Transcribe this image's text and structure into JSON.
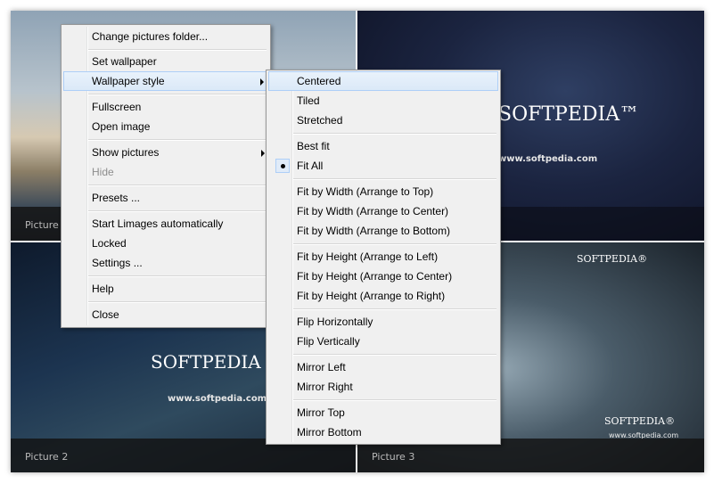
{
  "tiles": [
    {
      "caption": "Picture 1",
      "brand": "",
      "site": ""
    },
    {
      "caption": "",
      "brand": "SOFTPEDIA™",
      "site": "www.softpedia.com"
    },
    {
      "caption": "Picture 2",
      "brand": "SOFTPEDIA",
      "site": "www.softpedia.com"
    },
    {
      "caption": "Picture 3",
      "brand": "SOFTPEDIA®",
      "brand2": "SOFTPEDIA®",
      "site": "www.softpedia.com"
    }
  ],
  "context_menu": {
    "items": [
      {
        "label": "Change pictures folder..."
      },
      {
        "label": "Set wallpaper"
      },
      {
        "label": "Wallpaper style"
      },
      {
        "label": "Fullscreen"
      },
      {
        "label": "Open image"
      },
      {
        "label": "Show pictures"
      },
      {
        "label": "Hide"
      },
      {
        "label": "Presets ..."
      },
      {
        "label": "Start Limages automatically"
      },
      {
        "label": "Locked"
      },
      {
        "label": "Settings ..."
      },
      {
        "label": "Help"
      },
      {
        "label": "Close"
      }
    ]
  },
  "submenu": {
    "items": [
      {
        "label": "Centered"
      },
      {
        "label": "Tiled"
      },
      {
        "label": "Stretched"
      },
      {
        "label": "Best fit"
      },
      {
        "label": "Fit All"
      },
      {
        "label": "Fit by Width (Arrange to Top)"
      },
      {
        "label": "Fit by Width (Arrange to Center)"
      },
      {
        "label": "Fit by Width (Arrange to Bottom)"
      },
      {
        "label": "Fit by Height (Arrange to Left)"
      },
      {
        "label": "Fit by Height (Arrange to Center)"
      },
      {
        "label": "Fit by Height (Arrange to Right)"
      },
      {
        "label": "Flip Horizontally"
      },
      {
        "label": "Flip Vertically"
      },
      {
        "label": "Mirror Left"
      },
      {
        "label": "Mirror Right"
      },
      {
        "label": "Mirror Top"
      },
      {
        "label": "Mirror Bottom"
      }
    ],
    "selected": "Fit All",
    "highlighted": "Centered"
  }
}
